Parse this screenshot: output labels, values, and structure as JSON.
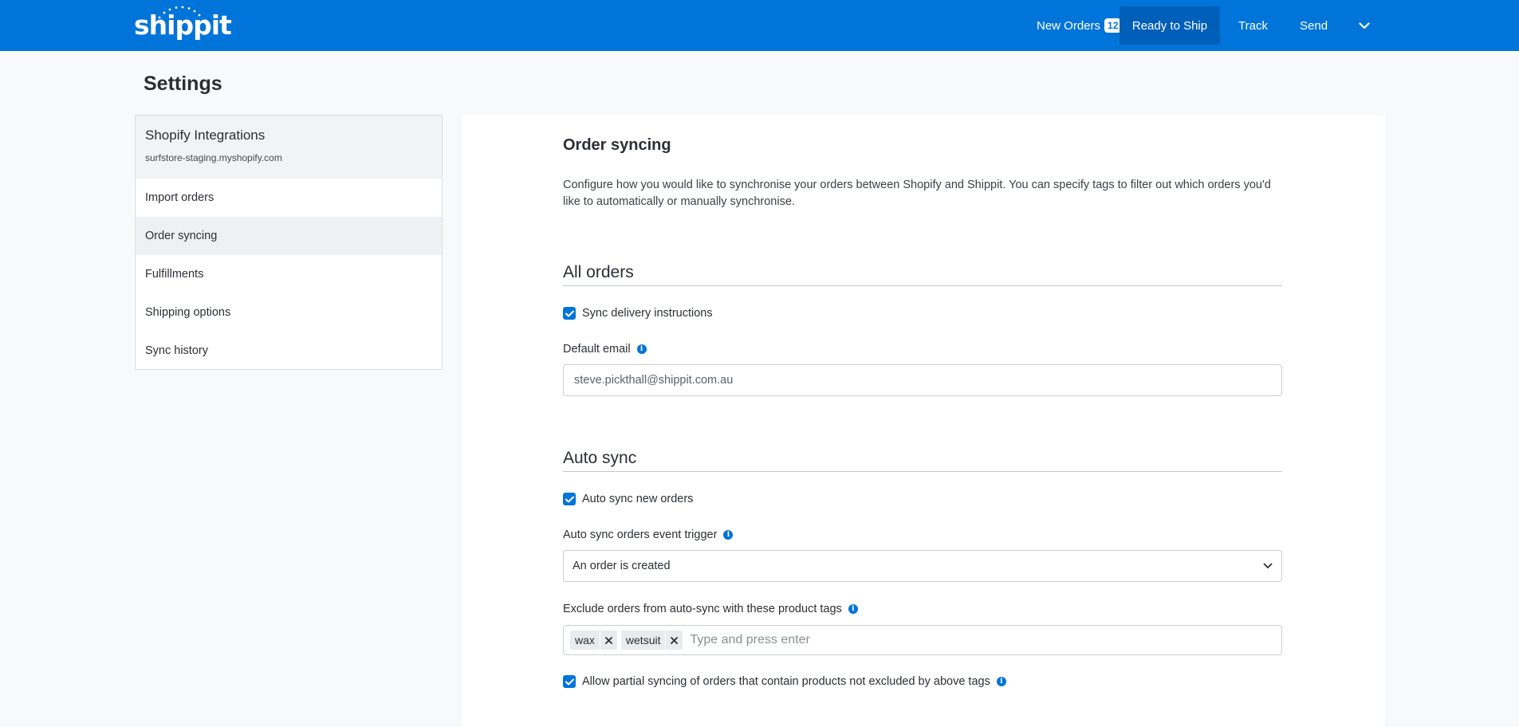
{
  "header": {
    "logo": "shippit",
    "nav": {
      "new_orders": "New Orders",
      "new_orders_count": "12",
      "ready_to_ship": "Ready to Ship",
      "track": "Track",
      "send": "Send"
    }
  },
  "page": {
    "title": "Settings"
  },
  "sidebar": {
    "title": "Shopify Integrations",
    "store": "surfstore-staging.myshopify.com",
    "items": [
      {
        "label": "Import orders",
        "active": false
      },
      {
        "label": "Order syncing",
        "active": true
      },
      {
        "label": "Fulfillments",
        "active": false
      },
      {
        "label": "Shipping options",
        "active": false
      },
      {
        "label": "Sync history",
        "active": false
      }
    ]
  },
  "main": {
    "heading": "Order syncing",
    "description": "Configure how you would like to synchronise your orders between Shopify and Shippit. You can specify tags to filter out which orders you'd like to automatically or manually synchronise.",
    "all_orders": {
      "heading": "All orders",
      "sync_delivery_label": "Sync delivery instructions",
      "sync_delivery_checked": true,
      "default_email_label": "Default email",
      "default_email_value": "steve.pickthall@shippit.com.au"
    },
    "auto_sync": {
      "heading": "Auto sync",
      "auto_sync_label": "Auto sync new orders",
      "auto_sync_checked": true,
      "trigger_label": "Auto sync orders event trigger",
      "trigger_value": "An order is created",
      "exclude_label": "Exclude orders from auto-sync with these product tags",
      "tags": [
        "wax",
        "wetsuit"
      ],
      "tags_placeholder": "Type and press enter",
      "partial_label": "Allow partial syncing of orders that contain products not excluded by above tags",
      "partial_checked": true
    }
  },
  "colors": {
    "brand": "#0074d9",
    "nav_active": "#005fb8"
  }
}
